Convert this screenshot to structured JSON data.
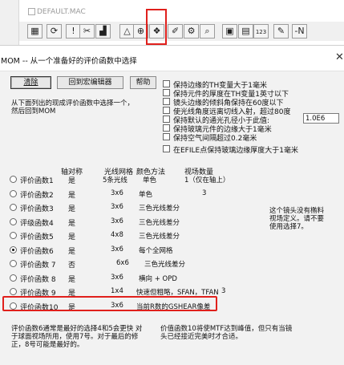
{
  "app_window": {
    "title": "DEFAULT.MAC",
    "toolbar": [
      {
        "name": "toolbar-list-button",
        "glyph": "▦"
      },
      {
        "name": "toolbar-refresh-button",
        "glyph": "⟳"
      },
      {
        "name": "toolbar-alert-button",
        "glyph": "!"
      },
      {
        "name": "toolbar-scissors-button",
        "glyph": "✂"
      },
      {
        "name": "toolbar-chart-button",
        "glyph": "▟"
      },
      {
        "name": "toolbar-triangle-button",
        "glyph": "△"
      },
      {
        "name": "toolbar-crosshair-button",
        "glyph": "⊕"
      },
      {
        "name": "toolbar-merit-function-button",
        "glyph": "❖"
      },
      {
        "name": "toolbar-tools-button",
        "glyph": "✐"
      },
      {
        "name": "toolbar-gear-button",
        "glyph": "⚙"
      },
      {
        "name": "toolbar-search-button",
        "glyph": "⌕"
      },
      {
        "name": "toolbar-save-button",
        "glyph": "▣"
      },
      {
        "name": "toolbar-disk-button",
        "glyph": "▤"
      },
      {
        "name": "toolbar-counter-button",
        "glyph": "123"
      },
      {
        "name": "toolbar-edit-button",
        "glyph": "✎"
      },
      {
        "name": "toolbar-next-button",
        "glyph": "-N"
      }
    ]
  },
  "dialog": {
    "title": "MOM -- 从一个准备好的评价函数中选择",
    "close_glyph": "✕",
    "buttons": {
      "clear": "清除",
      "macro_editor": "回到宏编辑器",
      "help": "帮助"
    },
    "instructions": "从下面列出的现成评价函数中选择一个，\n然后回到MOM",
    "options": [
      "保持边缘的TH变量大于1毫米",
      "保持元件的厚度在TH变量1英寸以下",
      "镜头边缘的倾斜角保持在60度以下",
      "使光线角度远离切线入射，超过80度",
      "保持默认的通光孔径小于此值:",
      "保持玻璃元件的边缘大于1毫米",
      "保持空气间隔超过0.2毫米",
      "在EFILE点保持玻璃边缘厚度大于1毫米"
    ],
    "diameter_value": "1.0E6",
    "headers": {
      "axial": "轴对称",
      "grid": "光线网格",
      "color": "颜色方法",
      "field": "视场数量"
    },
    "merit_functions": [
      {
        "label": "评价函数1",
        "axial": "是",
        "grid": "5条光线",
        "color": "单色",
        "field": "1（仅在轴上）"
      },
      {
        "label": "评价函数2",
        "axial": "是",
        "grid": "3x6",
        "color": "单色",
        "field": "3"
      },
      {
        "label": "评价函数3",
        "axial": "是",
        "grid": "3x6",
        "color": "三色光线差分",
        "field": ""
      },
      {
        "label": "评级函数4",
        "axial": "是",
        "grid": "3x6",
        "color": "三色光线差分",
        "field": ""
      },
      {
        "label": "评价函数5",
        "axial": "是",
        "grid": "4x8",
        "color": "三色光线差分",
        "field": ""
      },
      {
        "label": "评价函数6",
        "axial": "是",
        "grid": "3x6",
        "color": "每个全网格",
        "field": ""
      },
      {
        "label": "评价函数 7",
        "axial": "否",
        "grid": "6x6",
        "color": "三色光线差分",
        "field": ""
      },
      {
        "label": "评价函数 8",
        "axial": "是",
        "grid": "3x6",
        "color": "横向 + OPD",
        "field": ""
      },
      {
        "label": "评价函数 9",
        "axial": "是",
        "grid": "1x4",
        "color": "快速但粗略，SFAN，TFAN",
        "field": "3"
      },
      {
        "label": "评价函数10",
        "axial": "是",
        "grid": "3x6",
        "color": "当前R数的GSHEAR像差",
        "field": ""
      }
    ],
    "side_note": "这个镜头没有椭料\n视场定义。请不要\n使用选择7。",
    "bottom_left_note": "评价函数6通常是最好的选择4和5会更快 对\n于球面视场所用，使用7号。对于最后的修\n正，8号可能是最好的。",
    "bottom_right_note": "价值函数10将使MTF达到峰值，但只有当镜\n头已经接近完美时才合适。"
  }
}
